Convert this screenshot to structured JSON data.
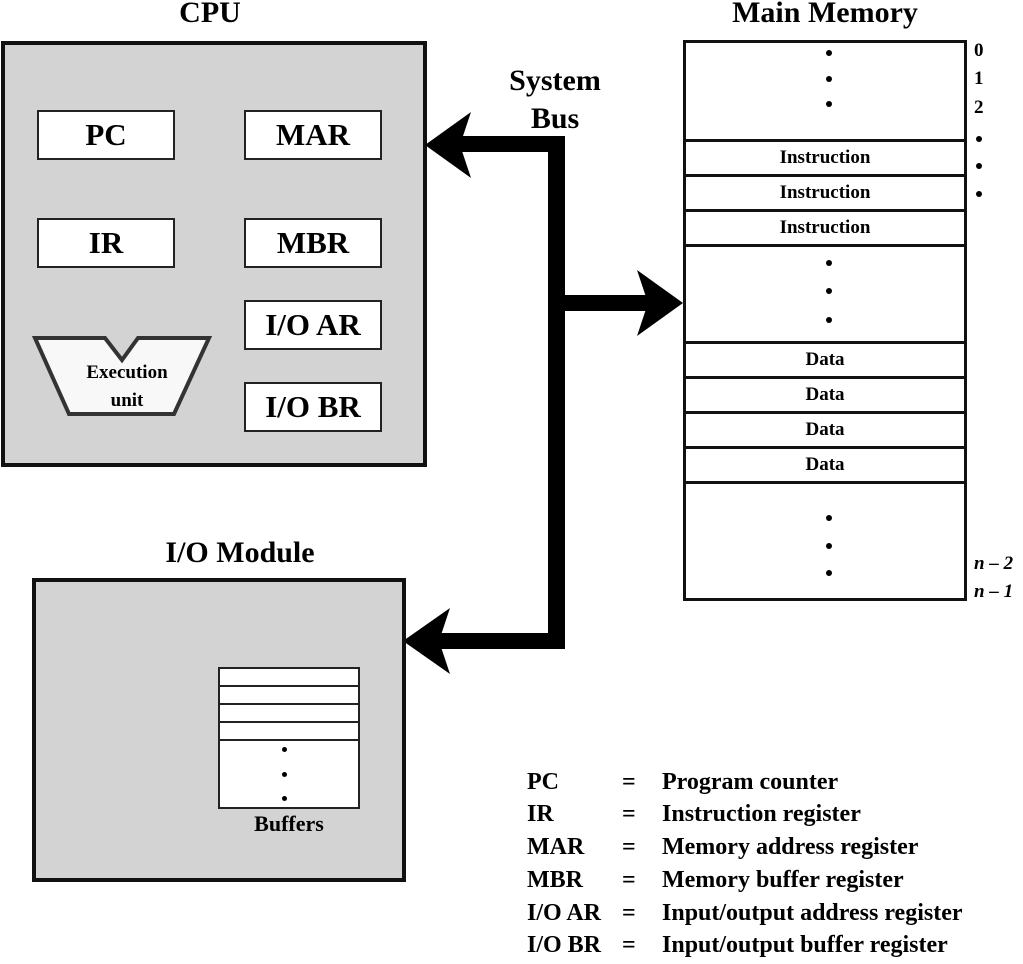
{
  "cpu": {
    "title": "CPU",
    "registers": {
      "pc": "PC",
      "mar": "MAR",
      "ir": "IR",
      "mbr": "MBR",
      "io_ar": "I/O AR",
      "io_br": "I/O BR"
    },
    "execution_unit": {
      "line1": "Execution",
      "line2": "unit"
    }
  },
  "bus": {
    "line1": "System",
    "line2": "Bus"
  },
  "memory": {
    "title": "Main Memory",
    "rows": [
      {
        "label": "Instruction"
      },
      {
        "label": "Instruction"
      },
      {
        "label": "Instruction"
      },
      {
        "label": "Data"
      },
      {
        "label": "Data"
      },
      {
        "label": "Data"
      },
      {
        "label": "Data"
      }
    ],
    "addresses": {
      "a0": "0",
      "a1": "1",
      "a2": "2",
      "n2": "n – 2",
      "n1": "n – 1"
    }
  },
  "io_module": {
    "title": "I/O Module",
    "buffers_label": "Buffers"
  },
  "legend": [
    {
      "abbr": "PC",
      "eq": "=",
      "desc": "Program counter"
    },
    {
      "abbr": "IR",
      "eq": "=",
      "desc": "Instruction register"
    },
    {
      "abbr": "MAR",
      "eq": "=",
      "desc": "Memory address register"
    },
    {
      "abbr": "MBR",
      "eq": "=",
      "desc": "Memory buffer register"
    },
    {
      "abbr": "I/O AR",
      "eq": "=",
      "desc": "Input/output address register"
    },
    {
      "abbr": "I/O BR",
      "eq": "=",
      "desc": "Input/output buffer register"
    }
  ]
}
